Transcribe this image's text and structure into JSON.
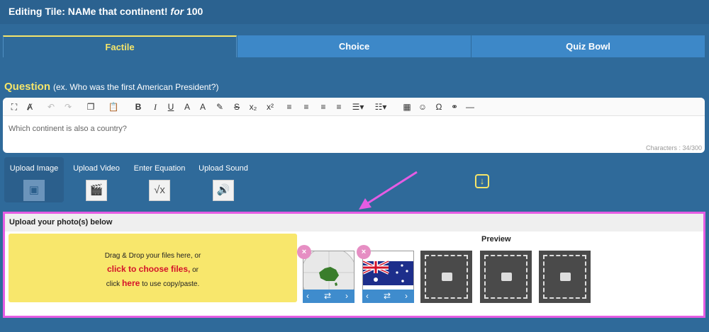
{
  "header": {
    "title_prefix": "Editing Tile: NAMe that continent!",
    "title_for": "for",
    "title_points": "100"
  },
  "tabs": [
    {
      "label": "Factile",
      "active": true
    },
    {
      "label": "Choice",
      "active": false
    },
    {
      "label": "Quiz Bowl",
      "active": false
    }
  ],
  "question": {
    "label": "Question",
    "hint": "(ex. Who was the first American President?)",
    "text": "Which continent is also a country?",
    "char_count": "Characters : 34/300"
  },
  "media_buttons": [
    {
      "label": "Upload Image",
      "icon": "image-icon",
      "active": true
    },
    {
      "label": "Upload Video",
      "icon": "video-icon",
      "active": false
    },
    {
      "label": "Enter Equation",
      "icon": "sqrt-icon",
      "active": false
    },
    {
      "label": "Upload Sound",
      "icon": "speaker-icon",
      "active": false
    }
  ],
  "upload": {
    "heading": "Upload your photo(s) below",
    "drop_line1": "Drag & Drop your files here, or",
    "choose_link": "click to choose files,",
    "drop_or": "or",
    "click_text": "click",
    "here_link": "here",
    "paste_text": "to use copy/paste.",
    "preview_label": "Preview"
  },
  "thumbnails": [
    {
      "name": "australia-globe",
      "remove_label": "×"
    },
    {
      "name": "australia-flag",
      "remove_label": "×"
    }
  ],
  "colors": {
    "accent": "#f5e56a",
    "highlight": "#e55ce3",
    "tab": "#3d88c8",
    "background": "#2f6a9a"
  }
}
